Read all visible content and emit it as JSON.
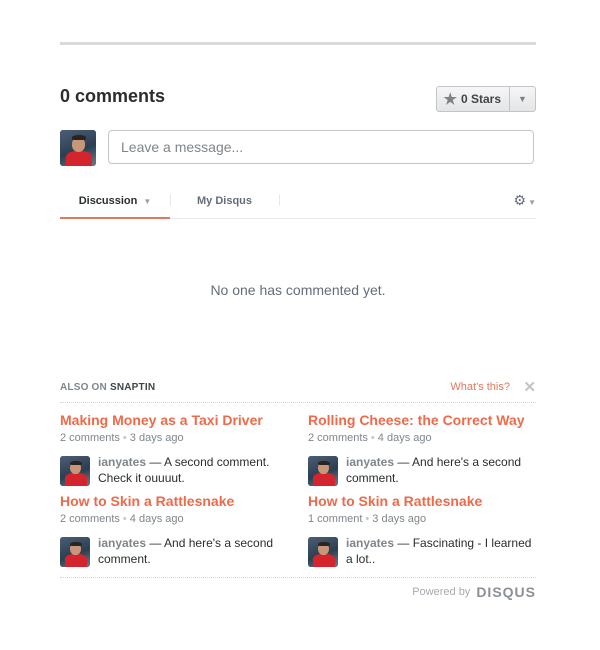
{
  "header": {
    "comment_count": "0 comments",
    "stars_label": "0 Stars"
  },
  "composer": {
    "placeholder": "Leave a message..."
  },
  "tabs": {
    "discussion": "Discussion",
    "my_disqus": "My Disqus"
  },
  "empty_state": "No one has commented yet.",
  "also_on": {
    "prefix": "ALSO ON",
    "site": "SNAPTIN",
    "whats_this": "What's this?"
  },
  "recommendations": [
    {
      "title": "Making Money as a Taxi Driver",
      "comments": "2 comments",
      "age": "3 days ago",
      "user": "ianyates",
      "excerpt": "— A second comment. Check it ouuuut."
    },
    {
      "title": "Rolling Cheese: the Correct Way",
      "comments": "2 comments",
      "age": "4 days ago",
      "user": "ianyates",
      "excerpt": "— And here's a second comment."
    },
    {
      "title": "How to Skin a Rattlesnake",
      "comments": "2 comments",
      "age": "4 days ago",
      "user": "ianyates",
      "excerpt": "— And here's a second comment."
    },
    {
      "title": "How to Skin a Rattlesnake",
      "comments": "1 comment",
      "age": "3 days ago",
      "user": "ianyates",
      "excerpt": "— Fascinating - I learned a lot.."
    }
  ],
  "footer": {
    "powered_by": "Powered by",
    "brand": "DISQUS"
  },
  "colors": {
    "accent": "#ef6a4a",
    "tab_underline": "#e2785c"
  }
}
